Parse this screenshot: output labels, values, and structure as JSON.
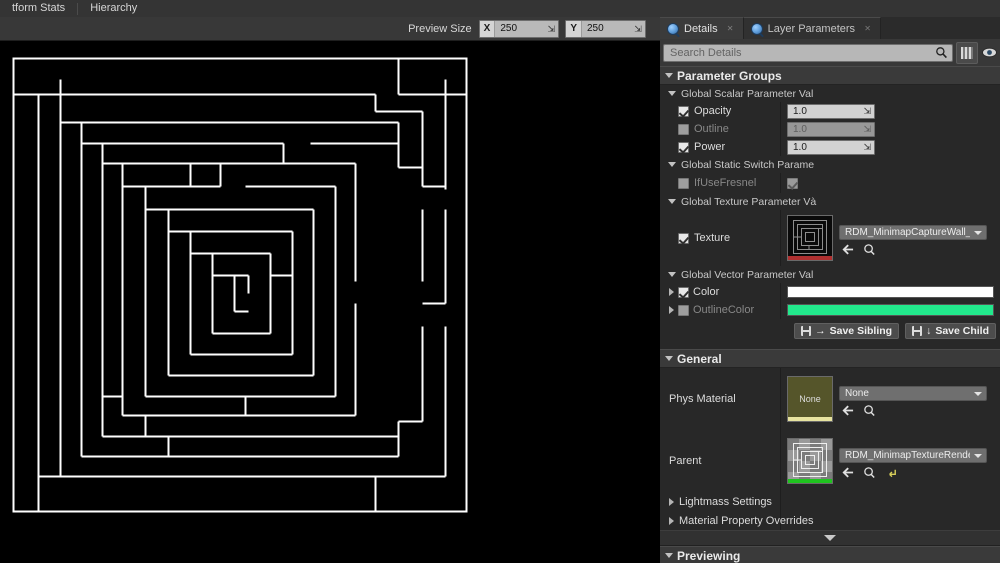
{
  "topbar": {
    "tabs": [
      {
        "label": "tform Stats"
      },
      {
        "label": "Hierarchy"
      }
    ]
  },
  "viewport_toolbar": {
    "preview_size_label": "Preview Size",
    "x_axis": "X",
    "x_value": "250",
    "y_axis": "Y",
    "y_value": "250"
  },
  "details_panel": {
    "tabs": [
      {
        "label": "Details",
        "icon": "magnifier-icon",
        "active": true
      },
      {
        "label": "Layer Parameters",
        "icon": "magnifier-icon",
        "active": false
      }
    ],
    "search": {
      "placeholder": "Search Details",
      "value": "",
      "icon": "search-icon"
    },
    "toolbar_icons": [
      {
        "name": "column-settings-icon"
      },
      {
        "name": "view-options-icon"
      }
    ],
    "categories": [
      {
        "title": "Parameter Groups",
        "groups": [
          {
            "title": "Global Scalar Parameter Val",
            "rows": [
              {
                "label": "Opacity",
                "checked": true,
                "enabled": true,
                "value": "1.0"
              },
              {
                "label": "Outline",
                "checked": false,
                "enabled": false,
                "value": "1.0"
              },
              {
                "label": "Power",
                "checked": true,
                "enabled": true,
                "value": "1.0"
              }
            ]
          },
          {
            "title": "Global Static Switch Parame",
            "rows": [
              {
                "label": "IfUseFresnel",
                "checked": false,
                "enabled": false,
                "switch_checked": true
              }
            ]
          },
          {
            "title": "Global Texture Parameter Và",
            "texture": {
              "label": "Texture",
              "checked": true,
              "asset_name": "RDM_MinimapCaptureWall_TextureR",
              "thumb_bar_color": "#b03030",
              "browse_icon": "browse-to-asset-icon",
              "find_icon": "find-in-content-browser-icon"
            }
          },
          {
            "title": "Global Vector Parameter Val",
            "vectors": [
              {
                "label": "Color",
                "checked": true,
                "enabled": true,
                "color": "#ffffff"
              },
              {
                "label": "OutlineColor",
                "checked": false,
                "enabled": false,
                "color": "#22e88c"
              }
            ]
          }
        ],
        "buttons": [
          {
            "label": "Save Sibling",
            "icon": "save-sibling-icon",
            "arrow": "→"
          },
          {
            "label": "Save Child",
            "icon": "save-child-icon",
            "arrow": "↓"
          }
        ]
      },
      {
        "title": "General",
        "asset_rows": [
          {
            "label": "Phys Material",
            "thumb_text": "None",
            "thumb_bg": "#55552a",
            "thumb_bar_color": "#e8e4a0",
            "value": "None",
            "icons": [
              "browse-to-asset-icon",
              "find-in-content-browser-icon"
            ]
          },
          {
            "label": "Parent",
            "thumb_text": "",
            "thumb_bg": "#7a7a7a",
            "thumb_bar_color": "#1fc41f",
            "value": "RDM_MinimapTextureRender_Mater",
            "icons": [
              "browse-to-asset-icon",
              "find-in-content-browser-icon",
              "reset-to-default-icon"
            ]
          }
        ],
        "sub_sections": [
          {
            "label": "Lightmass Settings"
          },
          {
            "label": "Material Property Overrides"
          }
        ]
      },
      {
        "title": "Previewing"
      }
    ]
  },
  "maze": {
    "stroke_color": "#ffffff",
    "background_color": "#000000",
    "description": "square spiral labyrinth preview"
  }
}
